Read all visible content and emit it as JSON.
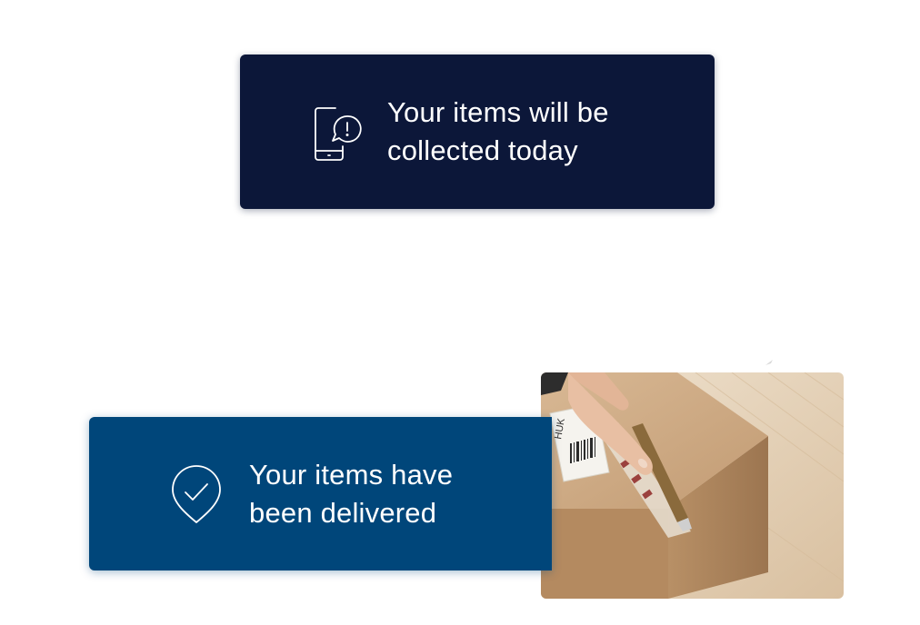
{
  "notifications": {
    "collected": {
      "icon": "phone-alert-icon",
      "text": "Your items will be\ncollected today",
      "background": "#0c1739"
    },
    "delivered": {
      "icon": "location-check-icon",
      "text": "Your items have\nbeen delivered",
      "background": "#00467a"
    }
  },
  "photo": {
    "subject": "box-opening-photo",
    "label_text": "HUK"
  }
}
